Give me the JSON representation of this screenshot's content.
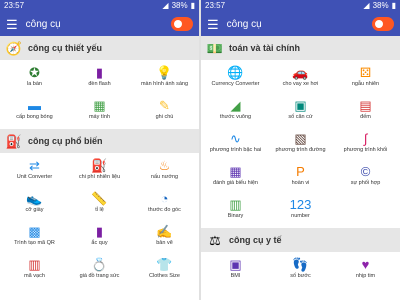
{
  "left": {
    "status": {
      "time": "23:57",
      "battery": "38%"
    },
    "appbar": {
      "title": "công cụ"
    },
    "sections": [
      {
        "title": "công cụ thiết yếu",
        "icon": "compass-icon",
        "icon_glyph": "🧭",
        "items": [
          {
            "label": "la bàn",
            "icon": "compass-icon",
            "glyph": "✪",
            "color": "#2e7d32"
          },
          {
            "label": "đèn flash",
            "icon": "flashlight-icon",
            "glyph": "▮",
            "color": "#7b1fa2"
          },
          {
            "label": "màn hình ánh sáng",
            "icon": "light-bulb-icon",
            "glyph": "💡",
            "color": "#c2185b"
          },
          {
            "label": "cấp bong bóng",
            "icon": "bubble-level-icon",
            "glyph": "▬",
            "color": "#1e88e5"
          },
          {
            "label": "máy tính",
            "icon": "calculator-icon",
            "glyph": "▦",
            "color": "#43a047"
          },
          {
            "label": "ghi chú",
            "icon": "note-icon",
            "glyph": "✎",
            "color": "#fbc02d"
          }
        ]
      },
      {
        "title": "công cụ phổ biến",
        "icon": "fuel-pump-icon",
        "icon_glyph": "⛽",
        "items": [
          {
            "label": "Unit Converter",
            "icon": "unit-converter-icon",
            "glyph": "⇄",
            "color": "#1e88e5"
          },
          {
            "label": "chi phí nhiên liệu",
            "icon": "fuel-cost-icon",
            "glyph": "⛽",
            "color": "#d32f2f"
          },
          {
            "label": "nấu nướng",
            "icon": "cooking-icon",
            "glyph": "♨",
            "color": "#f57c00"
          },
          {
            "label": "cỡ giày",
            "icon": "shoe-icon",
            "glyph": "👟",
            "color": "#1e88e5"
          },
          {
            "label": "tỉ lệ",
            "icon": "ruler-icon",
            "glyph": "📏",
            "color": "#fb8c00"
          },
          {
            "label": "thước đo góc",
            "icon": "protractor-icon",
            "glyph": "◔",
            "color": "#1565c0"
          },
          {
            "label": "Trình tạo mã QR",
            "icon": "qr-code-icon",
            "glyph": "▩",
            "color": "#1e88e5"
          },
          {
            "label": "ắc quy",
            "icon": "battery-icon",
            "glyph": "▮",
            "color": "#7b1fa2"
          },
          {
            "label": "bản vẽ",
            "icon": "drawing-icon",
            "glyph": "✍",
            "color": "#43a047"
          },
          {
            "label": "mã vạch",
            "icon": "barcode-icon",
            "glyph": "▥",
            "color": "#d32f2f"
          },
          {
            "label": "giá đồ trang sức",
            "icon": "jewelry-icon",
            "glyph": "💍",
            "color": "#00897b"
          },
          {
            "label": "Clothes Size",
            "icon": "clothes-icon",
            "glyph": "👕",
            "color": "#5e35b1"
          }
        ]
      }
    ]
  },
  "right": {
    "status": {
      "time": "23:57",
      "battery": "38%"
    },
    "appbar": {
      "title": "công cụ"
    },
    "sections": [
      {
        "title": "toán và tài chính",
        "icon": "money-icon",
        "icon_glyph": "💵",
        "items": [
          {
            "label": "Currency Converter",
            "icon": "currency-icon",
            "glyph": "🌐",
            "color": "#1e88e5"
          },
          {
            "label": "cho vay xe hơi",
            "icon": "car-loan-icon",
            "glyph": "🚗",
            "color": "#d32f2f"
          },
          {
            "label": "ngẫu nhiên",
            "icon": "dice-icon",
            "glyph": "⚄",
            "color": "#fb8c00"
          },
          {
            "label": "thước vuông",
            "icon": "square-ruler-icon",
            "glyph": "◢",
            "color": "#43a047"
          },
          {
            "label": "số căn cứ",
            "icon": "number-base-icon",
            "glyph": "▣",
            "color": "#00897b"
          },
          {
            "label": "đếm",
            "icon": "counter-icon",
            "glyph": "▤",
            "color": "#d32f2f"
          },
          {
            "label": "phương trình bậc hai",
            "icon": "quadratic-icon",
            "glyph": "∿",
            "color": "#1e88e5"
          },
          {
            "label": "phương trình đường",
            "icon": "line-equation-icon",
            "glyph": "▧",
            "color": "#5d4037"
          },
          {
            "label": "phương trình khối",
            "icon": "cubic-icon",
            "glyph": "∫",
            "color": "#d81b60"
          },
          {
            "label": "đánh giá biểu hiện",
            "icon": "expression-icon",
            "glyph": "▦",
            "color": "#5e35b1"
          },
          {
            "label": "hoàn vi",
            "icon": "percent-icon",
            "glyph": "P",
            "color": "#f57c00"
          },
          {
            "label": "sự phối hợp",
            "icon": "copyright-icon",
            "glyph": "©",
            "color": "#3949ab"
          },
          {
            "label": "Binary",
            "icon": "binary-icon",
            "glyph": "▥",
            "color": "#43a047"
          },
          {
            "label": "number",
            "icon": "number-icon",
            "glyph": "123",
            "color": "#1e88e5"
          }
        ]
      },
      {
        "title": "công cụ y tế",
        "icon": "scale-icon",
        "icon_glyph": "⚖",
        "items": [
          {
            "label": "BMI",
            "icon": "bmi-icon",
            "glyph": "▣",
            "color": "#5e35b1"
          },
          {
            "label": "số bước",
            "icon": "steps-icon",
            "glyph": "👣",
            "color": "#1e88e5"
          },
          {
            "label": "nhịp tim",
            "icon": "heart-rate-icon",
            "glyph": "♥",
            "color": "#8e24aa"
          }
        ]
      }
    ]
  }
}
